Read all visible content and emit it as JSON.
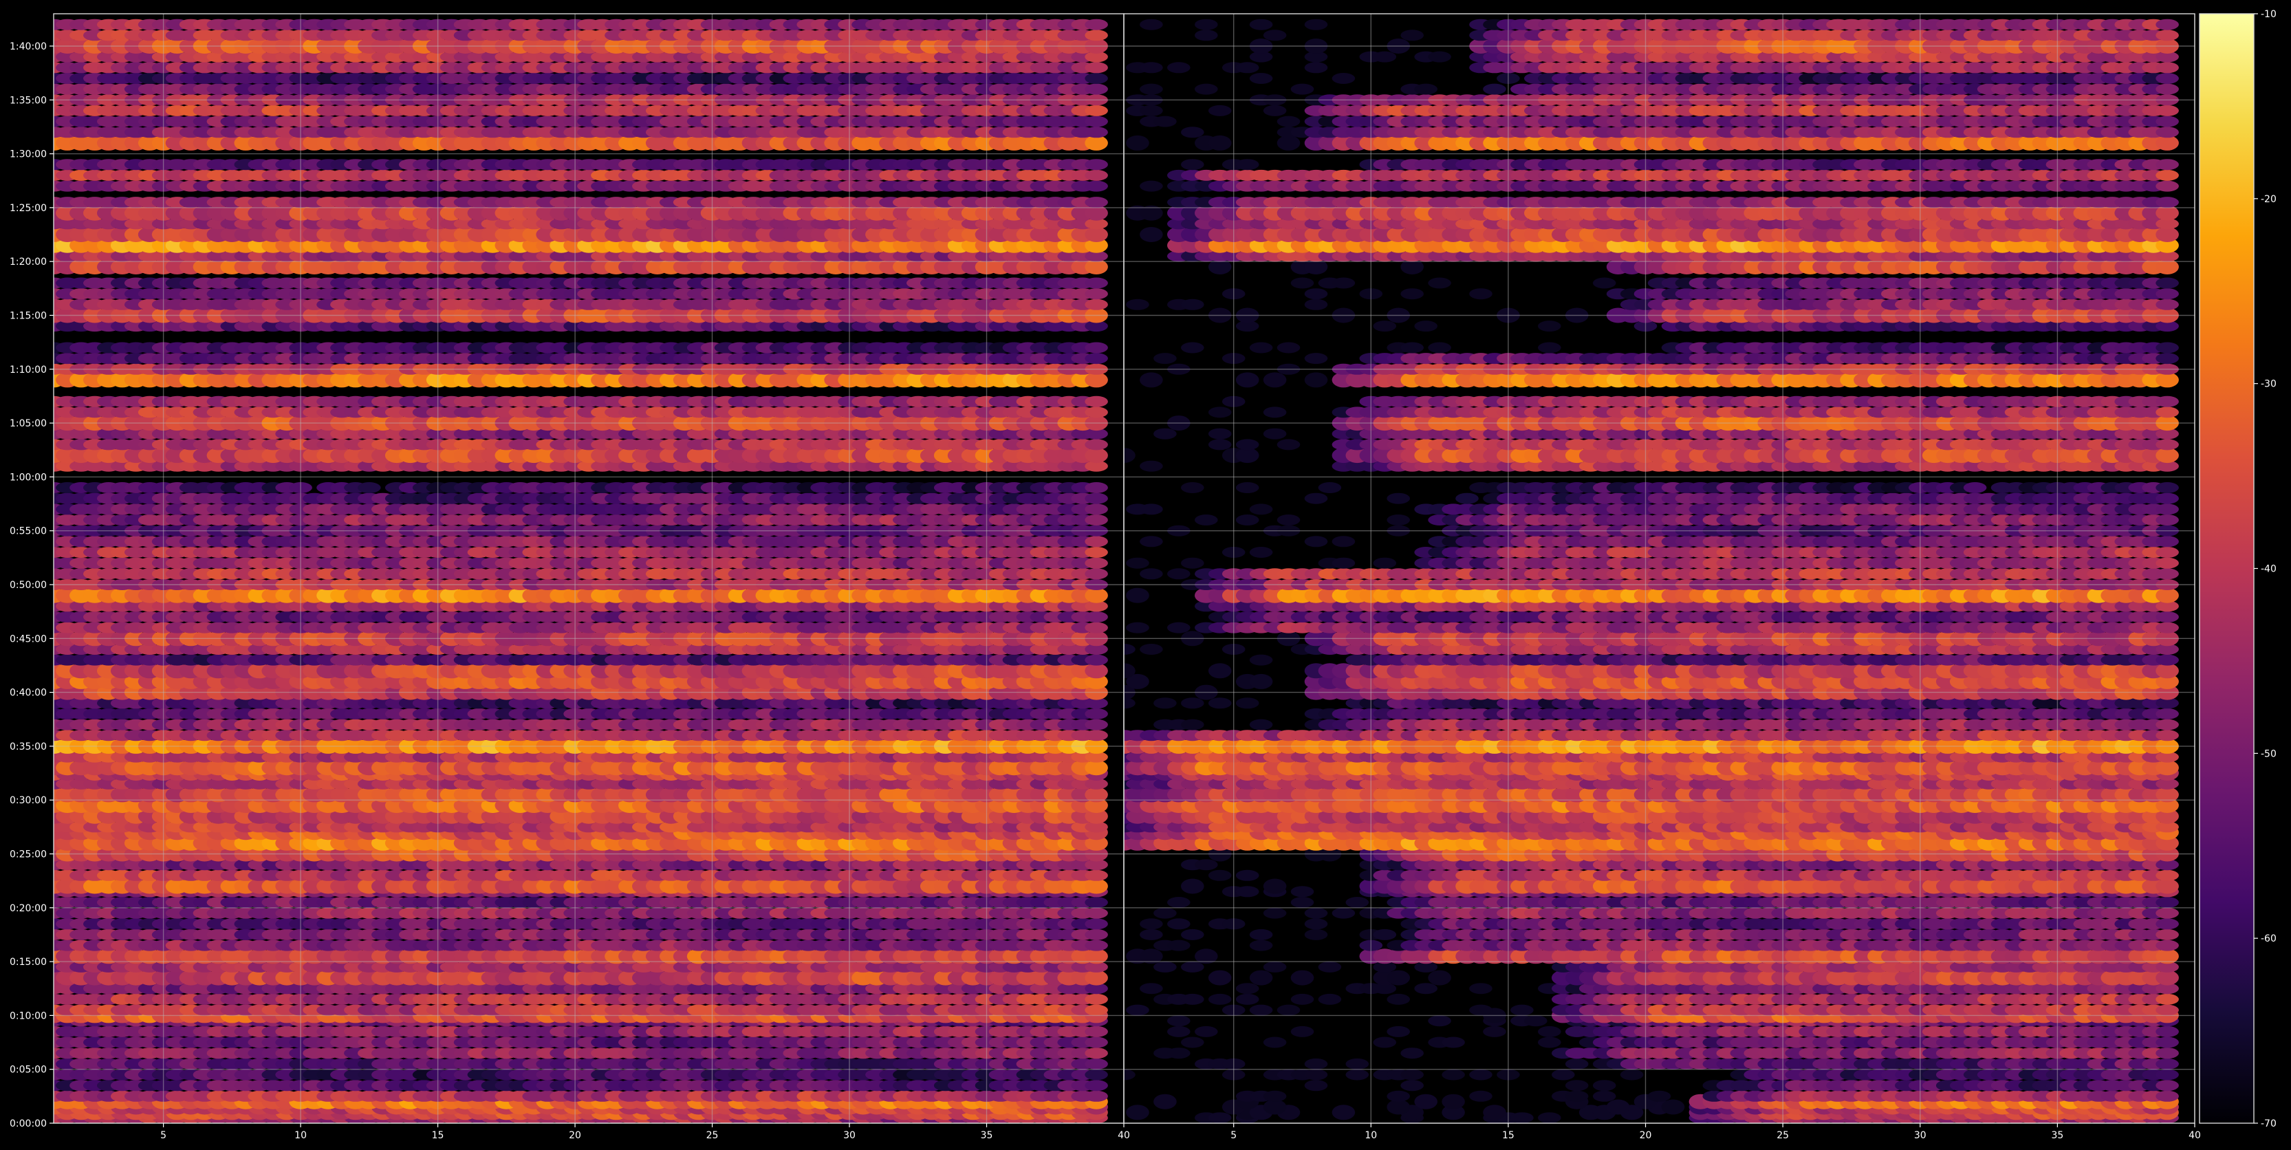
{
  "chart_data": {
    "type": "heatmap",
    "title": "",
    "xlabel": "",
    "ylabel": "",
    "colormap": "inferno",
    "background": "#000000",
    "grid": true,
    "colorbar": {
      "position": "right",
      "range": [
        -70,
        -10
      ],
      "tick_values": [
        -10,
        -20,
        -30,
        -40,
        -50,
        -60,
        -70
      ],
      "tick_labels": [
        "-10",
        "-20",
        "-30",
        "-40",
        "-50",
        "-60",
        "-70"
      ]
    },
    "y_axis": {
      "unit": "elapsed time (h:mm:ss)",
      "range_seconds": [
        0,
        6180
      ],
      "tick_values_seconds": [
        0,
        300,
        600,
        900,
        1200,
        1500,
        1800,
        2100,
        2400,
        2700,
        3000,
        3300,
        3600,
        3900,
        4200,
        4500,
        4800,
        5100,
        5400,
        5700,
        6000
      ],
      "tick_labels": [
        "0:00:00",
        "0:05:00",
        "0:10:00",
        "0:15:00",
        "0:20:00",
        "0:25:00",
        "0:30:00",
        "0:35:00",
        "0:40:00",
        "0:45:00",
        "0:50:00",
        "0:55:00",
        "1:00:00",
        "1:05:00",
        "1:10:00",
        "1:15:00",
        "1:20:00",
        "1:25:00",
        "1:30:00",
        "1:35:00",
        "1:40:00"
      ]
    },
    "panels": [
      {
        "name": "left",
        "x_range": [
          1,
          40
        ],
        "x_tick_values": [
          5,
          10,
          15,
          20,
          25,
          30,
          35,
          40
        ],
        "x_tick_labels": [
          "5",
          "10",
          "15",
          "20",
          "25",
          "30",
          "35",
          "40"
        ],
        "column_start": 1,
        "column_end": 39
      },
      {
        "name": "right",
        "x_range": [
          1,
          40
        ],
        "x_tick_values": [
          5,
          10,
          15,
          20,
          25,
          30,
          35,
          40
        ],
        "x_tick_labels": [
          "5",
          "10",
          "15",
          "20",
          "25",
          "30",
          "35",
          "40"
        ],
        "column_start": 1,
        "column_end": 39
      }
    ],
    "row_levels_db": [
      {
        "t": 30,
        "db": -44
      },
      {
        "t": 60,
        "db": -36
      },
      {
        "t": 90,
        "db": -38
      },
      {
        "t": 120,
        "db": -30
      },
      {
        "t": 150,
        "db": -42
      },
      {
        "t": 210,
        "db": -56
      },
      {
        "t": 270,
        "db": -58
      },
      {
        "t": 330,
        "db": -55
      },
      {
        "t": 390,
        "db": -48
      },
      {
        "t": 450,
        "db": -52
      },
      {
        "t": 510,
        "db": -46
      },
      {
        "t": 570,
        "db": -50
      },
      {
        "t": 600,
        "db": -34
      },
      {
        "t": 630,
        "db": -40
      },
      {
        "t": 690,
        "db": -42
      },
      {
        "t": 750,
        "db": -48
      },
      {
        "t": 810,
        "db": -38
      },
      {
        "t": 870,
        "db": -44
      },
      {
        "t": 930,
        "db": -36
      },
      {
        "t": 990,
        "db": -48
      },
      {
        "t": 1050,
        "db": -50
      },
      {
        "t": 1110,
        "db": -54
      },
      {
        "t": 1170,
        "db": -46
      },
      {
        "t": 1230,
        "db": -52
      },
      {
        "t": 1290,
        "db": -46
      },
      {
        "t": 1320,
        "db": -34
      },
      {
        "t": 1380,
        "db": -40
      },
      {
        "t": 1440,
        "db": -48
      },
      {
        "t": 1500,
        "db": -36
      },
      {
        "t": 1560,
        "db": -29
      },
      {
        "t": 1620,
        "db": -34
      },
      {
        "t": 1650,
        "db": -40
      },
      {
        "t": 1710,
        "db": -38
      },
      {
        "t": 1770,
        "db": -32
      },
      {
        "t": 1830,
        "db": -36
      },
      {
        "t": 1890,
        "db": -42
      },
      {
        "t": 1950,
        "db": -38
      },
      {
        "t": 1980,
        "db": -33
      },
      {
        "t": 2040,
        "db": -40
      },
      {
        "t": 2100,
        "db": -26
      },
      {
        "t": 2160,
        "db": -42
      },
      {
        "t": 2220,
        "db": -46
      },
      {
        "t": 2280,
        "db": -54
      },
      {
        "t": 2340,
        "db": -58
      },
      {
        "t": 2400,
        "db": -38
      },
      {
        "t": 2460,
        "db": -35
      },
      {
        "t": 2520,
        "db": -38
      },
      {
        "t": 2580,
        "db": -56
      },
      {
        "t": 2640,
        "db": -42
      },
      {
        "t": 2700,
        "db": -38
      },
      {
        "t": 2760,
        "db": -46
      },
      {
        "t": 2820,
        "db": -52
      },
      {
        "t": 2880,
        "db": -44
      },
      {
        "t": 2940,
        "db": -27
      },
      {
        "t": 3000,
        "db": -42
      },
      {
        "t": 3060,
        "db": -40
      },
      {
        "t": 3120,
        "db": -46
      },
      {
        "t": 3180,
        "db": -44
      },
      {
        "t": 3240,
        "db": -50
      },
      {
        "t": 3300,
        "db": -54
      },
      {
        "t": 3360,
        "db": -48
      },
      {
        "t": 3420,
        "db": -52
      },
      {
        "t": 3480,
        "db": -56
      },
      {
        "t": 3540,
        "db": -60
      },
      {
        "t": 3660,
        "db": -42
      },
      {
        "t": 3720,
        "db": -36
      },
      {
        "t": 3780,
        "db": -40
      },
      {
        "t": 3840,
        "db": -46
      },
      {
        "t": 3900,
        "db": -34
      },
      {
        "t": 3960,
        "db": -42
      },
      {
        "t": 4020,
        "db": -46
      },
      {
        "t": 4140,
        "db": -28
      },
      {
        "t": 4200,
        "db": -40
      },
      {
        "t": 4260,
        "db": -54
      },
      {
        "t": 4320,
        "db": -58
      },
      {
        "t": 4440,
        "db": -56
      },
      {
        "t": 4500,
        "db": -38
      },
      {
        "t": 4560,
        "db": -46
      },
      {
        "t": 4620,
        "db": -50
      },
      {
        "t": 4680,
        "db": -54
      },
      {
        "t": 4770,
        "db": -36
      },
      {
        "t": 4830,
        "db": -44
      },
      {
        "t": 4890,
        "db": -26
      },
      {
        "t": 4950,
        "db": -38
      },
      {
        "t": 5010,
        "db": -42
      },
      {
        "t": 5070,
        "db": -38
      },
      {
        "t": 5130,
        "db": -46
      },
      {
        "t": 5220,
        "db": -50
      },
      {
        "t": 5280,
        "db": -40
      },
      {
        "t": 5340,
        "db": -54
      },
      {
        "t": 5460,
        "db": -32
      },
      {
        "t": 5520,
        "db": -46
      },
      {
        "t": 5580,
        "db": -50
      },
      {
        "t": 5640,
        "db": -40
      },
      {
        "t": 5700,
        "db": -44
      },
      {
        "t": 5760,
        "db": -52
      },
      {
        "t": 5820,
        "db": -58
      },
      {
        "t": 5880,
        "db": -44
      },
      {
        "t": 5940,
        "db": -40
      },
      {
        "t": 6000,
        "db": -34
      },
      {
        "t": 6060,
        "db": -42
      },
      {
        "t": 6120,
        "db": -46
      }
    ],
    "right_panel_onset_columns": [
      {
        "t_max": 300,
        "col": 22
      },
      {
        "t_max": 900,
        "col": 17
      },
      {
        "t_max": 1500,
        "col": 10
      },
      {
        "t_max": 2200,
        "col": 1
      },
      {
        "t_max": 2700,
        "col": 8
      },
      {
        "t_max": 3100,
        "col": 4
      },
      {
        "t_max": 3600,
        "col": 12
      },
      {
        "t_max": 4300,
        "col": 9
      },
      {
        "t_max": 4800,
        "col": 19
      },
      {
        "t_max": 5300,
        "col": 3
      },
      {
        "t_max": 5700,
        "col": 8
      },
      {
        "t_max": 6200,
        "col": 14
      }
    ]
  }
}
